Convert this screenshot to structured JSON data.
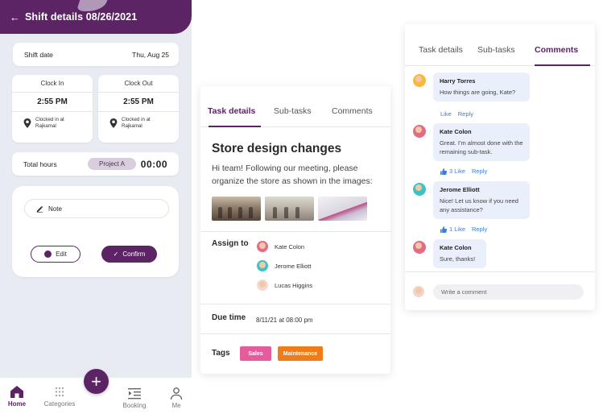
{
  "phone": {
    "header_title": "Shift details 08/26/2021",
    "shift_date": {
      "label": "Shift date",
      "value": "Thu, Aug 25"
    },
    "clock_in": {
      "label": "Clock In",
      "time": "2:55 PM",
      "location": "Clocked in at Rajkamal"
    },
    "clock_out": {
      "label": "Clock Out",
      "time": "2:55 PM",
      "location": "Clocked in at Rajkamal"
    },
    "total": {
      "label": "Total hours",
      "project": "Project A",
      "hours": "00:00"
    },
    "note_placeholder": "Note",
    "edit_label": "Edit",
    "confirm_label": "Confirm",
    "nav": {
      "home": "Home",
      "categories": "Categories",
      "booking": "Booking",
      "me": "Me"
    },
    "fab_label": "+"
  },
  "task": {
    "tabs": [
      "Task details",
      "Sub-tasks",
      "Comments"
    ],
    "active_tab": "Task details",
    "title": "Store design changes",
    "description": "Hi team! Following our meeting, please organize the store as shown in the images:",
    "assign_label": "Assign to",
    "assignees": [
      "Kate Colon",
      "Jerome Elliott",
      "Lucas Higgins"
    ],
    "due_label": "Due time",
    "due_value": "8/11/21 at 08:00 pm",
    "tags_label": "Tags",
    "tags": [
      {
        "label": "Sales",
        "color": "#e55c9d"
      },
      {
        "label": "Maintenance",
        "color": "#f07b17"
      }
    ]
  },
  "comments": {
    "tabs": [
      "Task details",
      "Sub-tasks",
      "Comments"
    ],
    "active_tab": "Comments",
    "items": [
      {
        "author": "Harry Torres",
        "text": "How things are going, Kate?",
        "like": "Like",
        "reply": "Reply"
      },
      {
        "author": "Kate Colon",
        "text": "Great. I'm almost done with the remaining sub-task.",
        "like": "3 Like",
        "reply": "Reply"
      },
      {
        "author": "Jerome Elliott",
        "text": "Nice! Let us know if you need any assistance?",
        "like": "1 Like",
        "reply": "Reply"
      },
      {
        "author": "Kate Colon",
        "text": "Sure, thanks!"
      }
    ],
    "write_placeholder": "Write a comment"
  },
  "colors": {
    "brand": "#5c2465",
    "link": "#3d7bd8",
    "bubble": "#e9f0fb"
  }
}
